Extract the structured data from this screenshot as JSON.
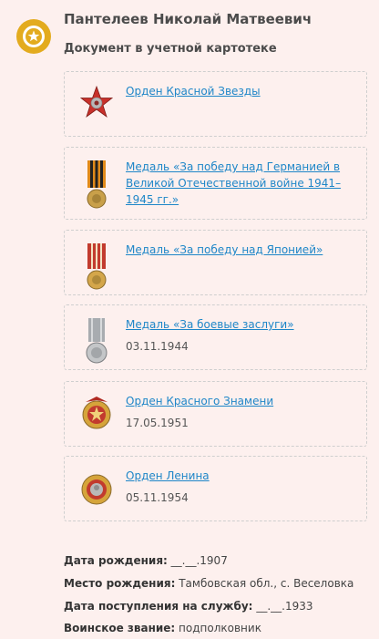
{
  "person": {
    "name": "Пантелеев Николай Матвеевич",
    "document_type": "Документ в учетной картотеке"
  },
  "awards": [
    {
      "title": "Орден Красной Звезды",
      "date": "",
      "icon": "red-star-order-icon"
    },
    {
      "title": "Медаль «За победу над Германией в Великой Отечественной войне 1941–1945 гг.»",
      "date": "",
      "icon": "victory-over-germany-medal-icon"
    },
    {
      "title": "Медаль «За победу над Японией»",
      "date": "",
      "icon": "victory-over-japan-medal-icon"
    },
    {
      "title": "Медаль «За боевые заслуги»",
      "date": "03.11.1944",
      "icon": "combat-merit-medal-icon"
    },
    {
      "title": "Орден Красного Знамени",
      "date": "17.05.1951",
      "icon": "red-banner-order-icon"
    },
    {
      "title": "Орден Ленина",
      "date": "05.11.1954",
      "icon": "lenin-order-icon"
    }
  ],
  "details": {
    "birth_date_label": "Дата рождения:",
    "birth_date_value": "__.__.1907",
    "birth_place_label": "Место рождения:",
    "birth_place_value": "Тамбовская обл., с. Веселовка",
    "service_start_label": "Дата поступления на службу:",
    "service_start_value": "__.__.1933",
    "rank_label": "Воинское звание:",
    "rank_value": "подполковник"
  },
  "colors": {
    "background": "#fdf0ee",
    "link": "#1e86c8",
    "logo_gold": "#e3ab1e"
  }
}
